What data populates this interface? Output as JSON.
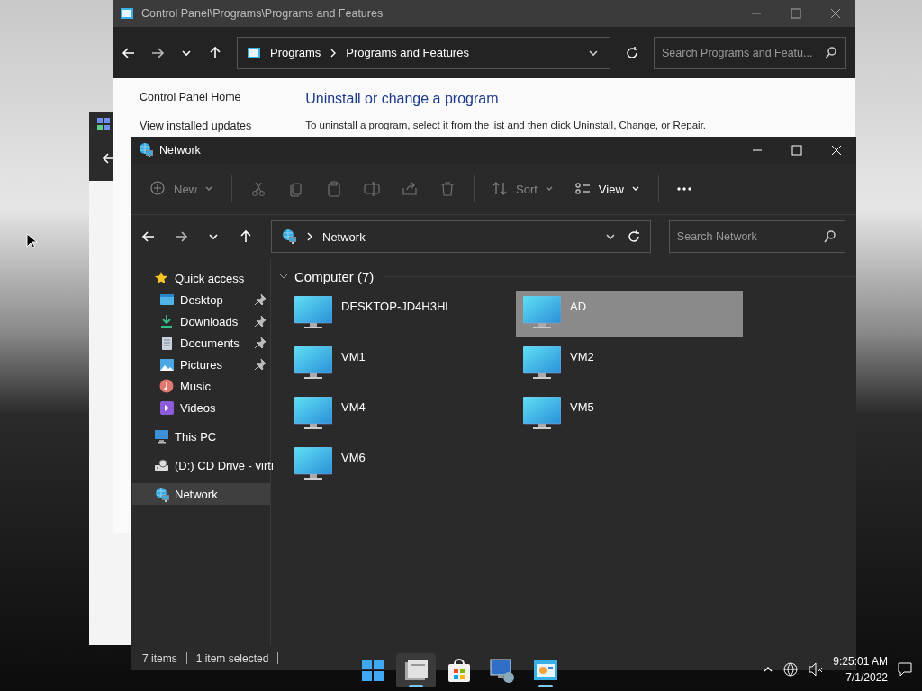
{
  "control_panel_window": {
    "title": "Control Panel\\Programs\\Programs and Features",
    "breadcrumb": [
      "Programs",
      "Programs and Features"
    ],
    "search": {
      "placeholder": "Search Programs and Featu..."
    },
    "sidebar_links": [
      "Control Panel Home",
      "View installed updates"
    ],
    "heading": "Uninstall or change a program",
    "instructions": "To uninstall a program, select it from the list and then click Uninstall, Change, or Repair."
  },
  "network_window": {
    "title": "Network",
    "toolbar": [
      {
        "kind": "menu",
        "label": "New",
        "disabled": true
      },
      {
        "kind": "icon",
        "disabled": true
      },
      {
        "kind": "icon",
        "disabled": true
      },
      {
        "kind": "icon",
        "disabled": true
      },
      {
        "kind": "icon",
        "disabled": true
      },
      {
        "kind": "icon",
        "disabled": true
      },
      {
        "kind": "icon",
        "disabled": true
      },
      {
        "kind": "menu",
        "label": "Sort",
        "disabled": true
      },
      {
        "kind": "menu",
        "label": "View",
        "disabled": false
      },
      {
        "kind": "icon",
        "disabled": false
      }
    ],
    "address": {
      "location": "Network"
    },
    "search": {
      "placeholder": "Search Network"
    },
    "sidebar": [
      {
        "label": "Quick access",
        "selected": false,
        "children": [
          {
            "label": "Desktop",
            "pinned": true,
            "selected": false
          },
          {
            "label": "Downloads",
            "pinned": true,
            "selected": false
          },
          {
            "label": "Documents",
            "pinned": true,
            "selected": false
          },
          {
            "label": "Pictures",
            "pinned": true,
            "selected": false
          },
          {
            "label": "Music",
            "pinned": false,
            "selected": false
          },
          {
            "label": "Videos",
            "pinned": false,
            "selected": false
          }
        ]
      },
      {
        "label": "This PC",
        "selected": false
      },
      {
        "label": "(D:) CD Drive - virti",
        "selected": false
      },
      {
        "label": "Network",
        "selected": true
      }
    ],
    "group": {
      "title": "Computer (7)",
      "expanded": true,
      "items": [
        {
          "name": "DESKTOP-JD4H3HL",
          "selected": false
        },
        {
          "name": "AD",
          "selected": true
        },
        {
          "name": "VM1",
          "selected": false
        },
        {
          "name": "VM2",
          "selected": false
        },
        {
          "name": "VM4",
          "selected": false
        },
        {
          "name": "VM5",
          "selected": false
        },
        {
          "name": "VM6",
          "selected": false
        }
      ]
    },
    "status_bar": [
      "7 items",
      "1 item selected"
    ]
  },
  "taskbar": {
    "apps": [
      {
        "selected": false,
        "running": false
      },
      {
        "selected": true,
        "running": true
      },
      {
        "selected": false,
        "running": false
      },
      {
        "selected": false,
        "running": false
      },
      {
        "selected": false,
        "running": true
      }
    ],
    "time": "9:25:01 AM",
    "date": "7/1/2022"
  }
}
